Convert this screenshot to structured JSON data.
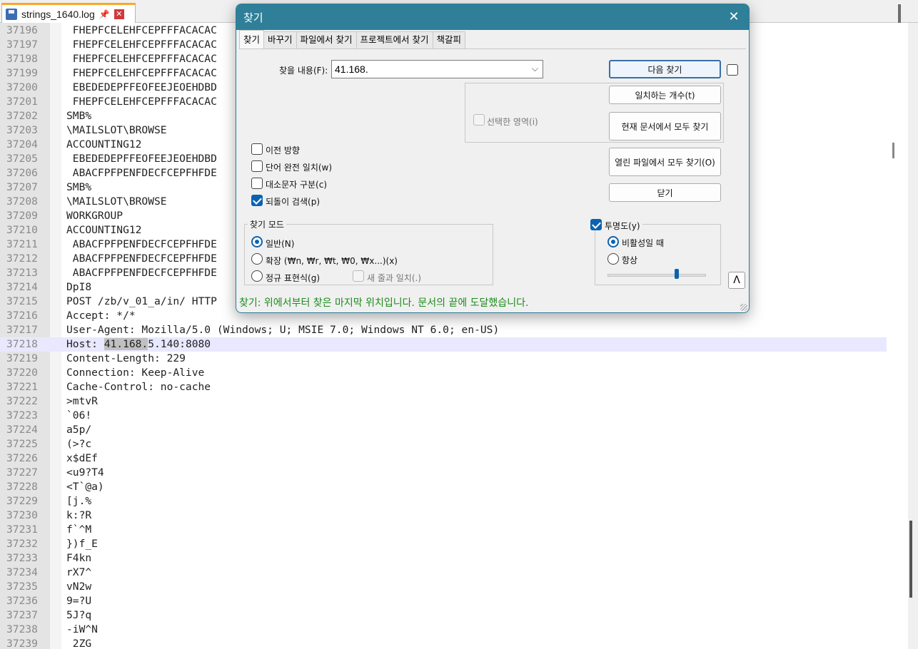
{
  "editor": {
    "tab_title": "strings_1640.log",
    "tab_pin_glyph": "📌",
    "tab_close_glyph": "✕",
    "lines": [
      {
        "num": "37196",
        "text": " FHEPFCELEHFCEPFFFACACAC"
      },
      {
        "num": "37197",
        "text": " FHEPFCELEHFCEPFFFACACAC"
      },
      {
        "num": "37198",
        "text": " FHEPFCELEHFCEPFFFACACAC"
      },
      {
        "num": "37199",
        "text": " FHEPFCELEHFCEPFFFACACAC"
      },
      {
        "num": "37200",
        "text": " EBEDEDEPFFEOFEEJEOEHDBD"
      },
      {
        "num": "37201",
        "text": " FHEPFCELEHFCEPFFFACACAC"
      },
      {
        "num": "37202",
        "text": "SMB%"
      },
      {
        "num": "37203",
        "text": "\\MAILSLOT\\BROWSE"
      },
      {
        "num": "37204",
        "text": "ACCOUNTING12"
      },
      {
        "num": "37205",
        "text": " EBEDEDEPFFEOFEEJEOEHDBD"
      },
      {
        "num": "37206",
        "text": " ABACFPFPENFDECFCEPFHFDE"
      },
      {
        "num": "37207",
        "text": "SMB%"
      },
      {
        "num": "37208",
        "text": "\\MAILSLOT\\BROWSE"
      },
      {
        "num": "37209",
        "text": "WORKGROUP"
      },
      {
        "num": "37210",
        "text": "ACCOUNTING12"
      },
      {
        "num": "37211",
        "text": " ABACFPFPENFDECFCEPFHFDE"
      },
      {
        "num": "37212",
        "text": " ABACFPFPENFDECFCEPFHFDE"
      },
      {
        "num": "37213",
        "text": " ABACFPFPENFDECFCEPFHFDE"
      },
      {
        "num": "37214",
        "text": "DpI8"
      },
      {
        "num": "37215",
        "text": "POST /zb/v_01_a/in/ HTTP"
      },
      {
        "num": "37216",
        "text": "Accept: */*"
      },
      {
        "num": "37217",
        "text": "User-Agent: Mozilla/5.0 (Windows; U; MSIE 7.0; Windows NT 6.0; en-US)"
      },
      {
        "num": "37218",
        "text": "Host: 41.168.5.140:8080"
      },
      {
        "num": "37219",
        "text": "Content-Length: 229"
      },
      {
        "num": "37220",
        "text": "Connection: Keep-Alive"
      },
      {
        "num": "37221",
        "text": "Cache-Control: no-cache"
      },
      {
        "num": "37222",
        "text": ">mtvR"
      },
      {
        "num": "37223",
        "text": "`06!"
      },
      {
        "num": "37224",
        "text": "a5p/"
      },
      {
        "num": "37225",
        "text": "(>?c"
      },
      {
        "num": "37226",
        "text": "x$dEf"
      },
      {
        "num": "37227",
        "text": "<u9?T4"
      },
      {
        "num": "37228",
        "text": "<T`@a)"
      },
      {
        "num": "37229",
        "text": "[j.%"
      },
      {
        "num": "37230",
        "text": "k:?R"
      },
      {
        "num": "37231",
        "text": "f`^M"
      },
      {
        "num": "37232",
        "text": "})f_E"
      },
      {
        "num": "37233",
        "text": "F4kn"
      },
      {
        "num": "37234",
        "text": "rX7^"
      },
      {
        "num": "37235",
        "text": "vN2w"
      },
      {
        "num": "37236",
        "text": "9=?U"
      },
      {
        "num": "37237",
        "text": "5J?q"
      },
      {
        "num": "37238",
        "text": "-iW^N"
      },
      {
        "num": "37239",
        "text": " 2ZG"
      }
    ],
    "current_line": "37218",
    "highlight": {
      "line": "37218",
      "before": "Host: ",
      "match": "41.168.",
      "after": "5.140:8080"
    }
  },
  "dialog": {
    "title": "찾기",
    "close_glyph": "✕",
    "tabs": [
      "찾기",
      "바꾸기",
      "파일에서 찾기",
      "프로젝트에서 찾기",
      "책갈피"
    ],
    "active_tab": 0,
    "find_label": "찾을 내용(F):",
    "find_value": "41.168.",
    "combo_arrow": "⌵",
    "buttons": {
      "find_next": "다음 찾기",
      "count": "일치하는 개수(t)",
      "find_all_current": "현재 문서에서 모두 찾기",
      "find_all_open": "열린 파일에서 모두 찾기(O)",
      "close": "닫기"
    },
    "in_selection": "선택한 영역(i)",
    "options": {
      "backward": "이전 방향",
      "whole_word": "단어 완전 일치(w)",
      "match_case": "대소문자 구분(c)",
      "wrap_around": "되돌이 검색(p)"
    },
    "search_mode": {
      "title": "찾기 모드",
      "normal": "일반(N)",
      "extended": "확장 (₩n, ₩r, ₩t, ₩0, ₩x...)(x)",
      "regex": "정규 표현식(g)",
      "dot_newline": "새 줄과 일치(.)"
    },
    "transparency": {
      "title": "투명도(y)",
      "on_losing_focus": "비활성일 때",
      "always": "항상",
      "level": 0.7
    },
    "up_glyph": "Λ",
    "status": "찾기: 위에서부터 찾은 마지막 위치입니다. 문서의 끝에 도달했습니다."
  }
}
